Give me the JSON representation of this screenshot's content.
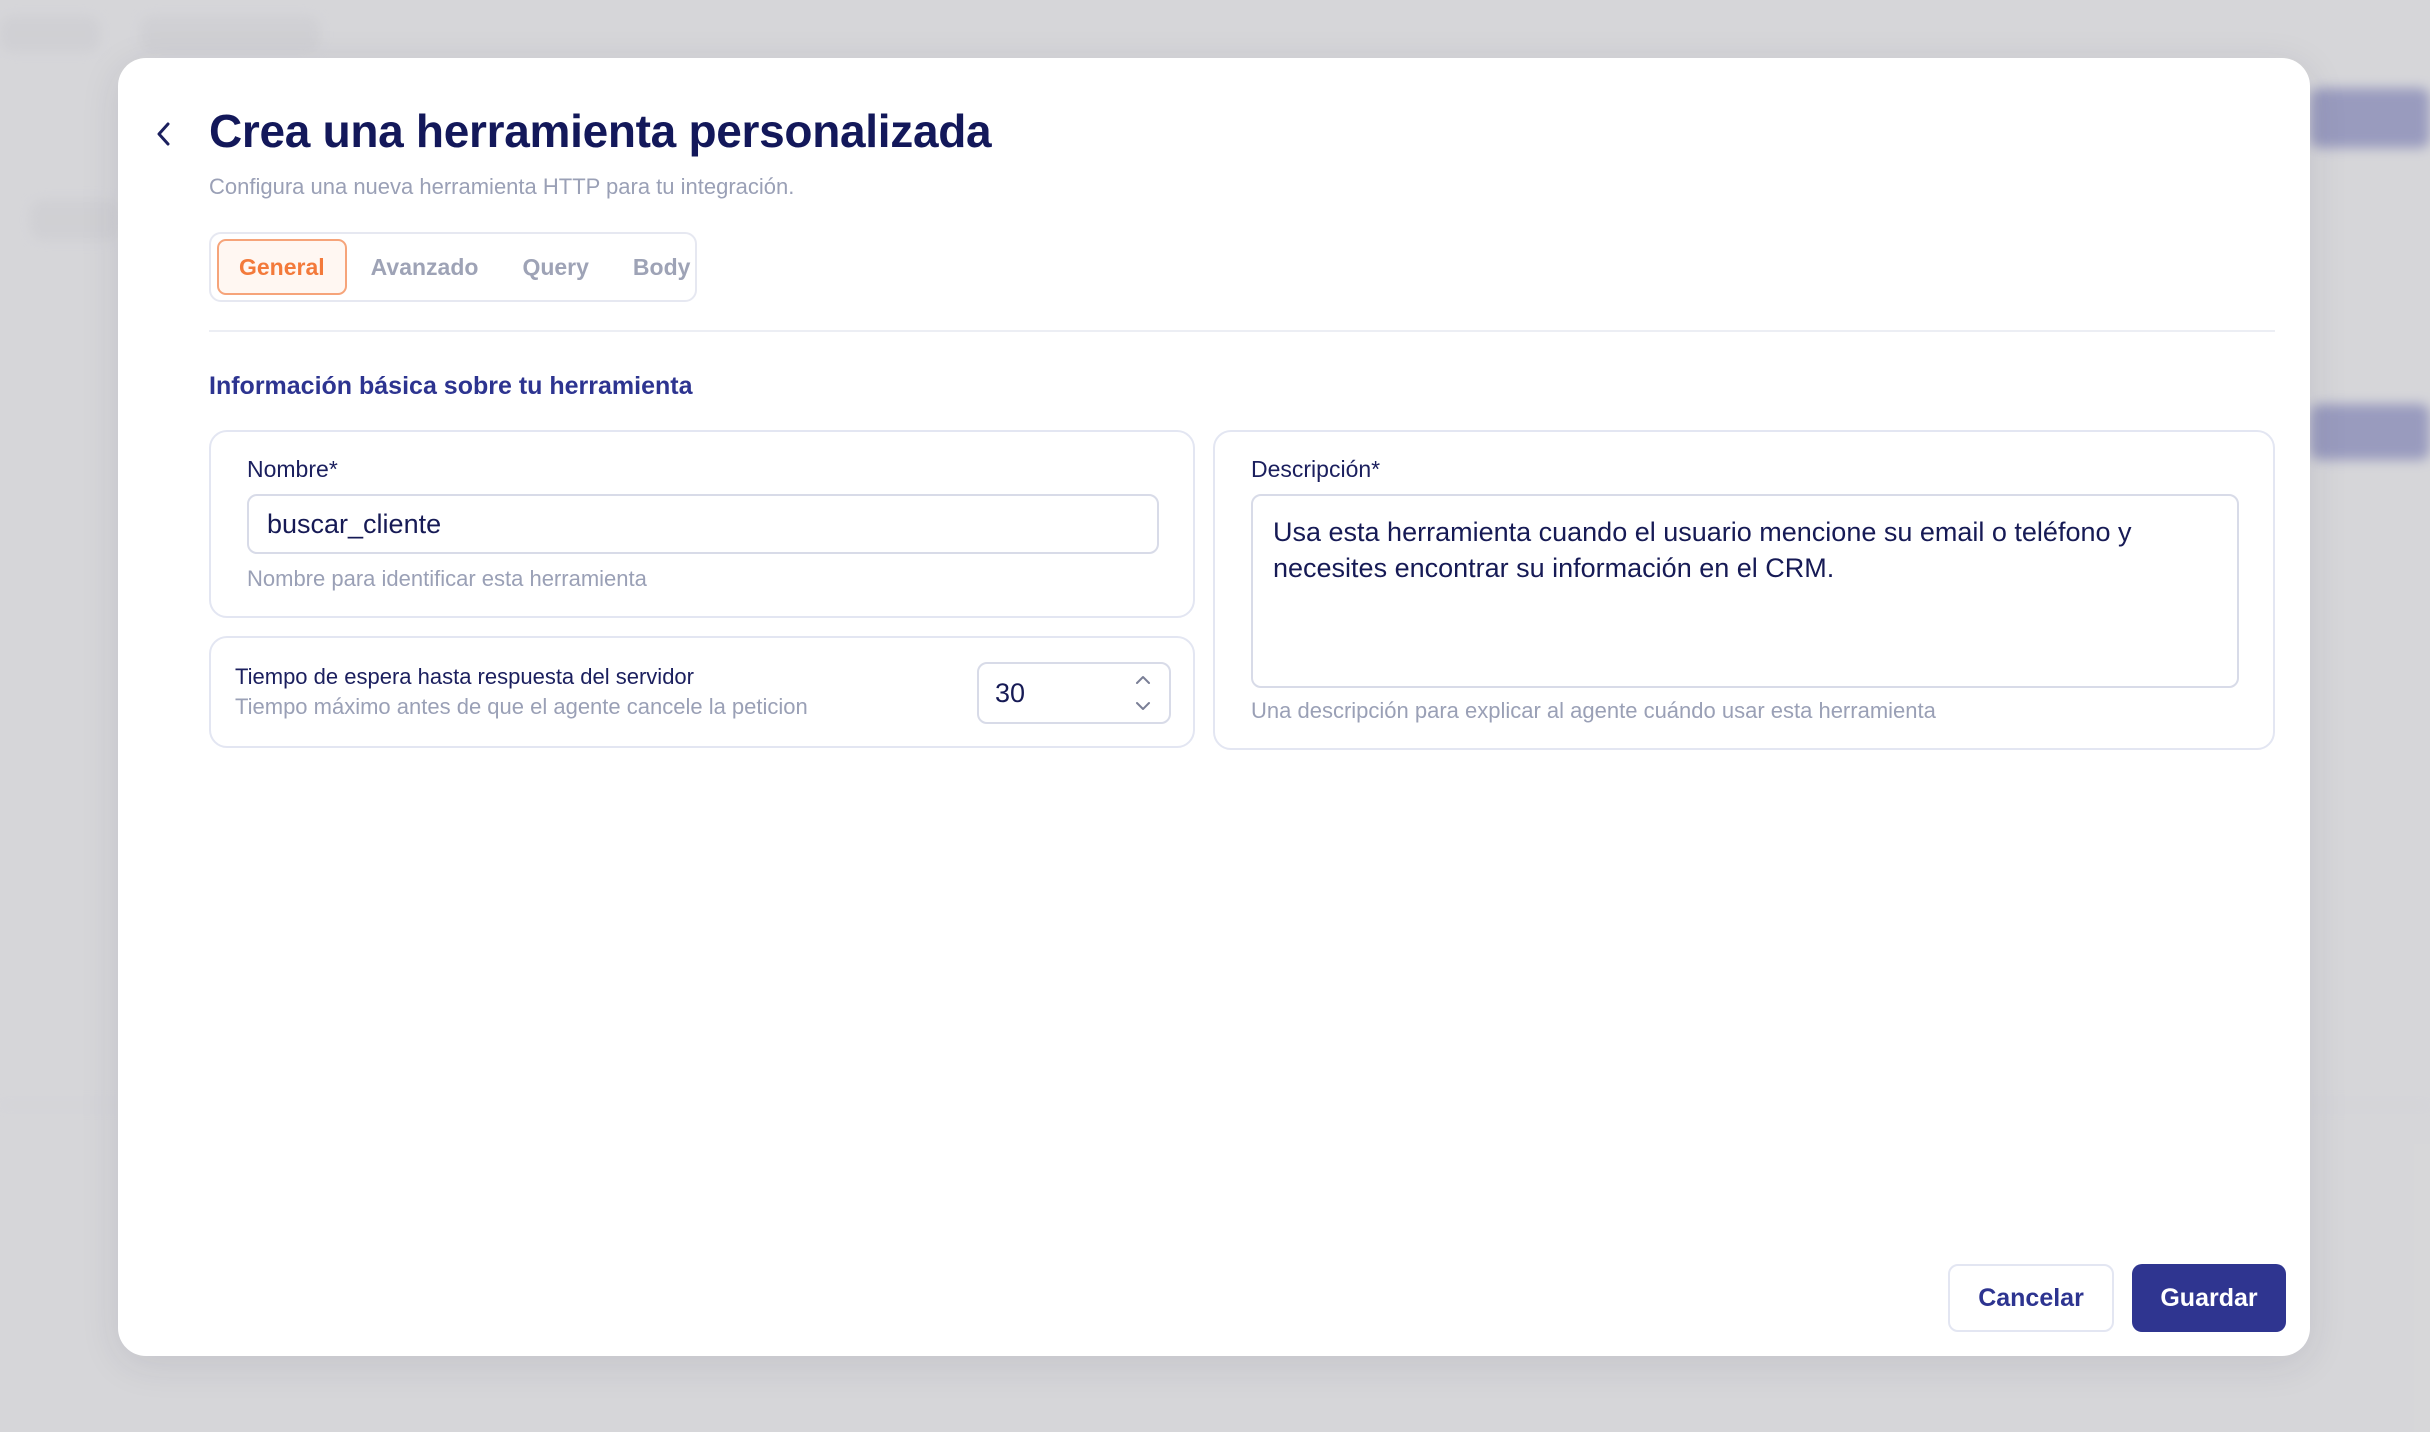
{
  "modal": {
    "title": "Crea una herramienta personalizada",
    "subtitle": "Configura una nueva herramienta HTTP para tu integración."
  },
  "tabs": [
    {
      "label": "General",
      "active": true
    },
    {
      "label": "Avanzado",
      "active": false
    },
    {
      "label": "Query",
      "active": false
    },
    {
      "label": "Body",
      "active": false
    }
  ],
  "section": {
    "title": "Información básica sobre tu herramienta"
  },
  "name_field": {
    "label": "Nombre",
    "required_mark": "*",
    "value": "buscar_cliente",
    "hint": "Nombre para identificar esta herramienta"
  },
  "timeout_field": {
    "label": "Tiempo de espera hasta respuesta del servidor",
    "hint": "Tiempo máximo antes de que el agente cancele la peticion",
    "value": "30"
  },
  "description_field": {
    "label": "Descripción",
    "required_mark": "*",
    "value": "Usa esta herramienta cuando el usuario mencione su email o teléfono y\nnecesites encontrar su información en el CRM.",
    "hint": "Una descripción para explicar al agente cuándo usar esta herramienta"
  },
  "footer": {
    "cancel_label": "Cancelar",
    "save_label": "Guardar"
  },
  "colors": {
    "primary": "#2f3590",
    "title": "#13185a",
    "active_tab": "#f37a3b",
    "muted": "#9aa0b6"
  }
}
